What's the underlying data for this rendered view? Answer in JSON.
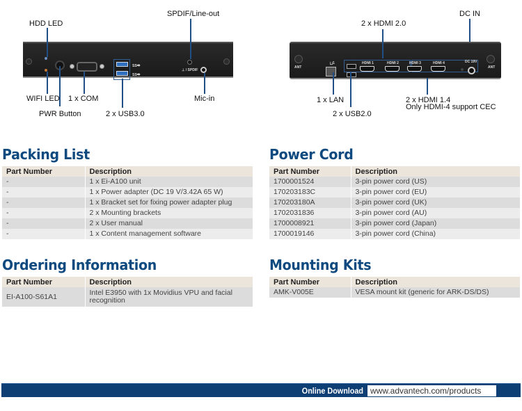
{
  "front_panel": {
    "callouts": {
      "hdd_led": "HDD LED",
      "spdif": "SPDIF/Line-out",
      "wifi_led": "WIFI LED",
      "com": "1 x COM",
      "pwr": "PWR Button",
      "usb3": "2 x USB3.0",
      "mic": "Mic-in"
    },
    "port_labels": {
      "spdif": "⊥ / SPDIF",
      "usb3_a": "SS⮕",
      "usb3_b": "SS⮕"
    }
  },
  "rear_panel": {
    "callouts": {
      "hdmi20": "2 x HDMI 2.0",
      "dcin": "DC IN",
      "lan": "1 x LAN",
      "usb2": "2 x USB2.0",
      "hdmi14_line1": "2 x HDMI 1.4",
      "hdmi14_line2": "Only HDMI-4 support CEC"
    },
    "port_labels": {
      "ant_left": "ANT",
      "ant_right": "ANT",
      "lan": "⨆1",
      "hdmi1": "HDMI 1",
      "hdmi2": "HDMI 2",
      "hdmi3": "HDMI 3",
      "hdmi4": "HDMI 4",
      "dc": "DC 19V"
    }
  },
  "packing_list": {
    "title": "Packing List",
    "headers": [
      "Part Number",
      "Description"
    ],
    "rows": [
      [
        "-",
        "1 x Ei-A100 unit"
      ],
      [
        "-",
        "1 x Power adapter (DC 19 V/3.42A 65 W)"
      ],
      [
        "-",
        "1 x Bracket set for fixing power adapter plug"
      ],
      [
        "-",
        "2 x Mounting brackets"
      ],
      [
        "-",
        "2 x User manual"
      ],
      [
        "-",
        "1 x Content management software"
      ]
    ]
  },
  "power_cord": {
    "title": "Power Cord",
    "headers": [
      "Part Number",
      "Description"
    ],
    "rows": [
      [
        "1700001524",
        "3-pin power cord (US)"
      ],
      [
        "170203183C",
        "3-pin power cord (EU)"
      ],
      [
        "170203180A",
        "3-pin power cord (UK)"
      ],
      [
        "1702031836",
        "3-pin power cord (AU)"
      ],
      [
        "1700008921",
        "3-pin power cord (Japan)"
      ],
      [
        "1700019146",
        "3-pin power cord (China)"
      ]
    ]
  },
  "ordering_info": {
    "title": "Ordering Information",
    "headers": [
      "Part Number",
      "Description"
    ],
    "rows": [
      [
        "EI-A100-S61A1",
        "Intel E3950 with 1x Movidius VPU and facial recognition"
      ]
    ]
  },
  "mounting_kits": {
    "title": "Mounting Kits",
    "headers": [
      "Part Number",
      "Description"
    ],
    "rows": [
      [
        "AMK-V005E",
        "VESA mount kit (generic for ARK-DS/DS)"
      ]
    ]
  },
  "footer": {
    "label": "Online Download",
    "url": "www.advantech.com/products"
  },
  "colors": {
    "heading": "#0e4a7f",
    "footer_bar": "#0e3f74",
    "table_header": "#ece5dc",
    "callout_line": "#1f4f86"
  }
}
